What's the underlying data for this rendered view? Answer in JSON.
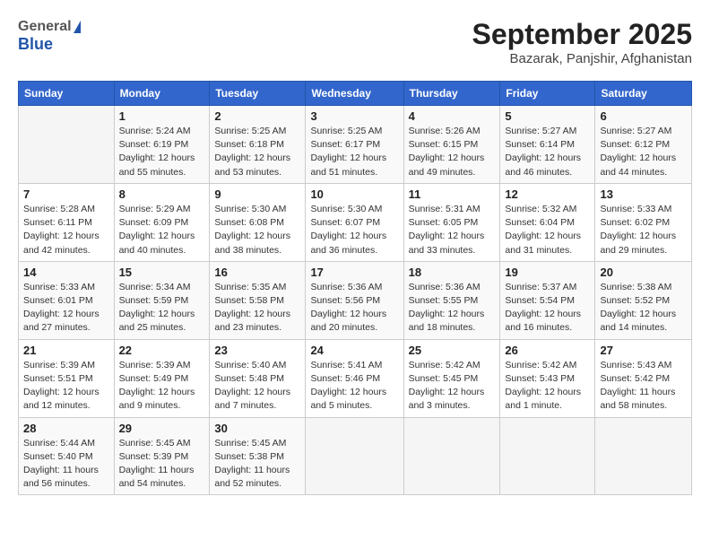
{
  "header": {
    "logo_general": "General",
    "logo_blue": "Blue",
    "month_title": "September 2025",
    "location": "Bazarak, Panjshir, Afghanistan"
  },
  "days_of_week": [
    "Sunday",
    "Monday",
    "Tuesday",
    "Wednesday",
    "Thursday",
    "Friday",
    "Saturday"
  ],
  "weeks": [
    [
      {
        "day": "",
        "info": ""
      },
      {
        "day": "1",
        "info": "Sunrise: 5:24 AM\nSunset: 6:19 PM\nDaylight: 12 hours\nand 55 minutes."
      },
      {
        "day": "2",
        "info": "Sunrise: 5:25 AM\nSunset: 6:18 PM\nDaylight: 12 hours\nand 53 minutes."
      },
      {
        "day": "3",
        "info": "Sunrise: 5:25 AM\nSunset: 6:17 PM\nDaylight: 12 hours\nand 51 minutes."
      },
      {
        "day": "4",
        "info": "Sunrise: 5:26 AM\nSunset: 6:15 PM\nDaylight: 12 hours\nand 49 minutes."
      },
      {
        "day": "5",
        "info": "Sunrise: 5:27 AM\nSunset: 6:14 PM\nDaylight: 12 hours\nand 46 minutes."
      },
      {
        "day": "6",
        "info": "Sunrise: 5:27 AM\nSunset: 6:12 PM\nDaylight: 12 hours\nand 44 minutes."
      }
    ],
    [
      {
        "day": "7",
        "info": "Sunrise: 5:28 AM\nSunset: 6:11 PM\nDaylight: 12 hours\nand 42 minutes."
      },
      {
        "day": "8",
        "info": "Sunrise: 5:29 AM\nSunset: 6:09 PM\nDaylight: 12 hours\nand 40 minutes."
      },
      {
        "day": "9",
        "info": "Sunrise: 5:30 AM\nSunset: 6:08 PM\nDaylight: 12 hours\nand 38 minutes."
      },
      {
        "day": "10",
        "info": "Sunrise: 5:30 AM\nSunset: 6:07 PM\nDaylight: 12 hours\nand 36 minutes."
      },
      {
        "day": "11",
        "info": "Sunrise: 5:31 AM\nSunset: 6:05 PM\nDaylight: 12 hours\nand 33 minutes."
      },
      {
        "day": "12",
        "info": "Sunrise: 5:32 AM\nSunset: 6:04 PM\nDaylight: 12 hours\nand 31 minutes."
      },
      {
        "day": "13",
        "info": "Sunrise: 5:33 AM\nSunset: 6:02 PM\nDaylight: 12 hours\nand 29 minutes."
      }
    ],
    [
      {
        "day": "14",
        "info": "Sunrise: 5:33 AM\nSunset: 6:01 PM\nDaylight: 12 hours\nand 27 minutes."
      },
      {
        "day": "15",
        "info": "Sunrise: 5:34 AM\nSunset: 5:59 PM\nDaylight: 12 hours\nand 25 minutes."
      },
      {
        "day": "16",
        "info": "Sunrise: 5:35 AM\nSunset: 5:58 PM\nDaylight: 12 hours\nand 23 minutes."
      },
      {
        "day": "17",
        "info": "Sunrise: 5:36 AM\nSunset: 5:56 PM\nDaylight: 12 hours\nand 20 minutes."
      },
      {
        "day": "18",
        "info": "Sunrise: 5:36 AM\nSunset: 5:55 PM\nDaylight: 12 hours\nand 18 minutes."
      },
      {
        "day": "19",
        "info": "Sunrise: 5:37 AM\nSunset: 5:54 PM\nDaylight: 12 hours\nand 16 minutes."
      },
      {
        "day": "20",
        "info": "Sunrise: 5:38 AM\nSunset: 5:52 PM\nDaylight: 12 hours\nand 14 minutes."
      }
    ],
    [
      {
        "day": "21",
        "info": "Sunrise: 5:39 AM\nSunset: 5:51 PM\nDaylight: 12 hours\nand 12 minutes."
      },
      {
        "day": "22",
        "info": "Sunrise: 5:39 AM\nSunset: 5:49 PM\nDaylight: 12 hours\nand 9 minutes."
      },
      {
        "day": "23",
        "info": "Sunrise: 5:40 AM\nSunset: 5:48 PM\nDaylight: 12 hours\nand 7 minutes."
      },
      {
        "day": "24",
        "info": "Sunrise: 5:41 AM\nSunset: 5:46 PM\nDaylight: 12 hours\nand 5 minutes."
      },
      {
        "day": "25",
        "info": "Sunrise: 5:42 AM\nSunset: 5:45 PM\nDaylight: 12 hours\nand 3 minutes."
      },
      {
        "day": "26",
        "info": "Sunrise: 5:42 AM\nSunset: 5:43 PM\nDaylight: 12 hours\nand 1 minute."
      },
      {
        "day": "27",
        "info": "Sunrise: 5:43 AM\nSunset: 5:42 PM\nDaylight: 11 hours\nand 58 minutes."
      }
    ],
    [
      {
        "day": "28",
        "info": "Sunrise: 5:44 AM\nSunset: 5:40 PM\nDaylight: 11 hours\nand 56 minutes."
      },
      {
        "day": "29",
        "info": "Sunrise: 5:45 AM\nSunset: 5:39 PM\nDaylight: 11 hours\nand 54 minutes."
      },
      {
        "day": "30",
        "info": "Sunrise: 5:45 AM\nSunset: 5:38 PM\nDaylight: 11 hours\nand 52 minutes."
      },
      {
        "day": "",
        "info": ""
      },
      {
        "day": "",
        "info": ""
      },
      {
        "day": "",
        "info": ""
      },
      {
        "day": "",
        "info": ""
      }
    ]
  ]
}
